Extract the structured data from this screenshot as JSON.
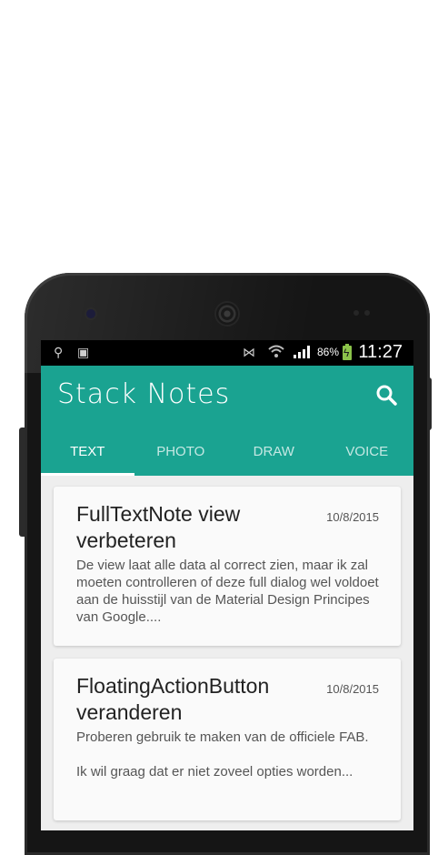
{
  "status_bar": {
    "battery_percent": "86%",
    "time": "11:27"
  },
  "app_bar": {
    "title": "Stack Notes",
    "search_icon": "search-icon",
    "color": "#1aa391"
  },
  "tabs": [
    {
      "label": "TEXT",
      "active": true
    },
    {
      "label": "PHOTO",
      "active": false
    },
    {
      "label": "DRAW",
      "active": false
    },
    {
      "label": "VOICE",
      "active": false
    }
  ],
  "notes": [
    {
      "title": "FullTextNote view verbeteren",
      "date": "10/8/2015",
      "body": "De view laat alle data al correct zien, maar ik zal moeten controlleren of deze full dialog wel voldoet aan de huisstijl van de Material Design Principes van Google...."
    },
    {
      "title": "FloatingActionButton veranderen",
      "date": "10/8/2015",
      "body": "Proberen gebruik te maken van de officiele FAB.\n\nIk wil graag dat er niet zoveel opties worden..."
    }
  ]
}
